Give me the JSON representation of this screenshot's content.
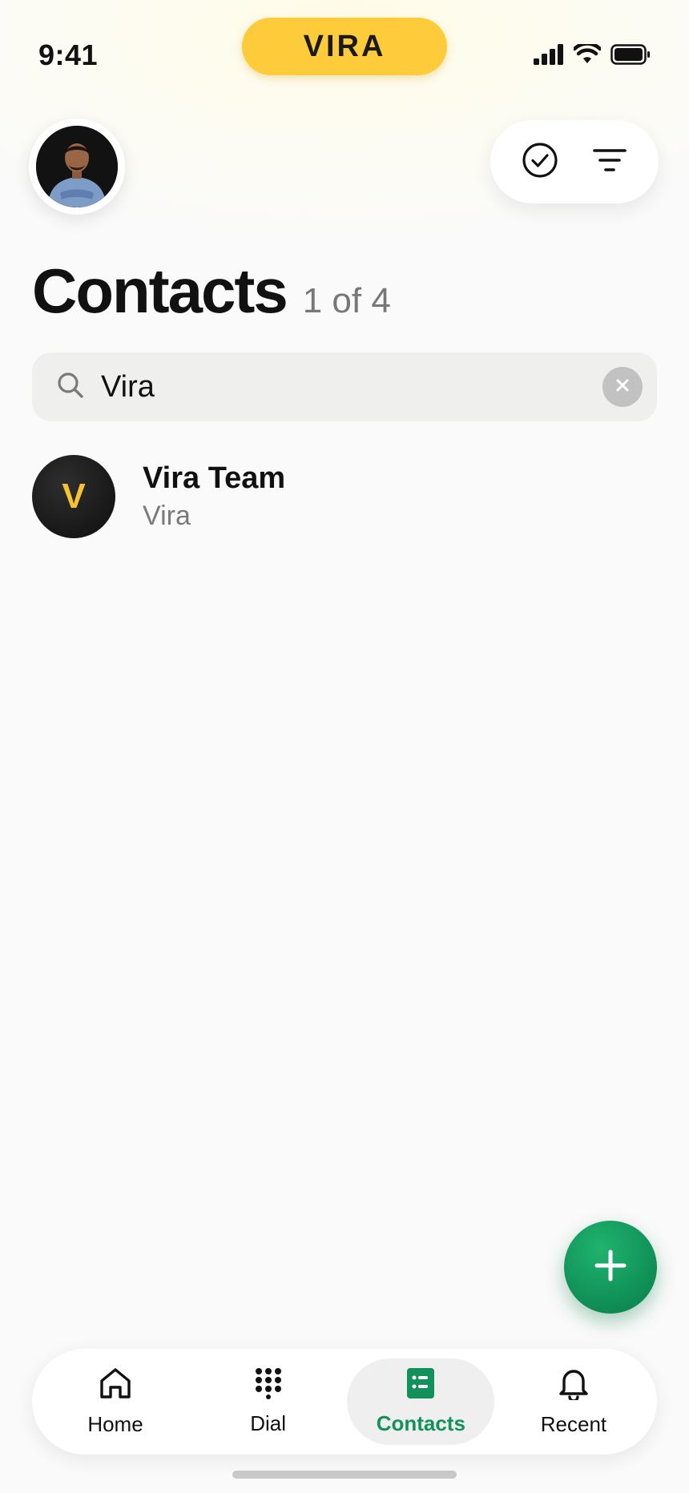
{
  "status_bar": {
    "time": "9:41",
    "brand": "VIRA",
    "icons": [
      "cellular-signal-icon",
      "wifi-icon",
      "battery-icon"
    ]
  },
  "header": {
    "avatar": "profile-avatar",
    "actions": [
      "check-circle-icon",
      "filter-icon"
    ]
  },
  "page": {
    "title": "Contacts",
    "count": "1 of 4"
  },
  "search": {
    "value": "Vira",
    "placeholder": "Search"
  },
  "contacts": [
    {
      "initial": "V",
      "name": "Vira Team",
      "subtitle": "Vira"
    }
  ],
  "fab": {
    "icon": "plus-icon"
  },
  "nav": {
    "items": [
      {
        "label": "Home",
        "icon": "home-icon",
        "active": false
      },
      {
        "label": "Dial",
        "icon": "dialpad-icon",
        "active": false
      },
      {
        "label": "Contacts",
        "icon": "contacts-book-icon",
        "active": true
      },
      {
        "label": "Recent",
        "icon": "bell-icon",
        "active": false
      }
    ]
  },
  "colors": {
    "brand_yellow": "#fecb3a",
    "accent_green": "#12925a",
    "background": "#fafafa"
  }
}
